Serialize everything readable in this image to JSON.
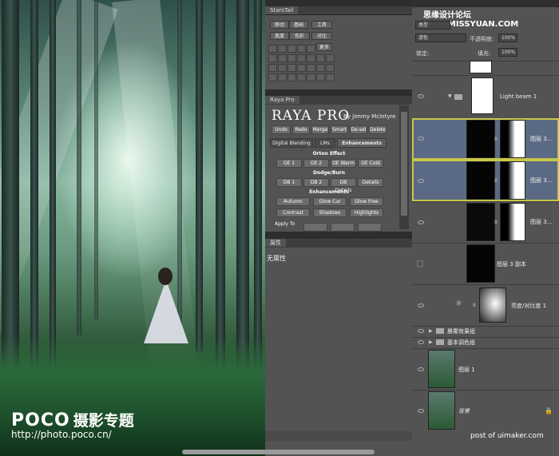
{
  "watermark": {
    "brand": "POCO",
    "subtitle": "摄影专题",
    "url": "http://photo.poco.cn/"
  },
  "top_watermark": "思缘设计论坛 www.MISSYUAN.COM",
  "startail": {
    "tab": "StarsTail",
    "buttons": [
      "移动",
      "基础",
      "工具",
      "真度",
      "色彩",
      "对比",
      "更多"
    ]
  },
  "raya": {
    "tab": "Raya Pro",
    "title": "RAYA PRO",
    "by": "By Jimmy McIntyre",
    "top_buttons": [
      "Undo",
      "Redo",
      "Merge",
      "Smart",
      "De-sel",
      "Delete"
    ],
    "tabs": [
      "Digital Blending",
      "LMs",
      "Enhancements"
    ],
    "orton_title": "Orton Effect",
    "orton": [
      "OE 1",
      "OE 2",
      "OE Warm",
      "OE Cold"
    ],
    "dodge_title": "Dodge/Burn",
    "dodge": [
      "DB 1",
      "DB 2",
      "DB Details",
      "Details"
    ],
    "enh_title": "Enhancements",
    "enh_row1": [
      "Autumn",
      "Glow Cur",
      "Glow Free"
    ],
    "enh_row2": [
      "Contrast",
      "Shadows",
      "Highlights"
    ],
    "apply_to": "Apply To"
  },
  "properties": {
    "tab": "属性",
    "empty": "无属性"
  },
  "layers_panel": {
    "kind": "类型",
    "blend": "滤色",
    "opacity_label": "不透明度:",
    "opacity": "100%",
    "lock_label": "锁定:",
    "fill_label": "填充:",
    "fill": "100%",
    "layers": [
      {
        "name": "Light beam 1"
      },
      {
        "name": "图层 3..."
      },
      {
        "name": "图层 3..."
      },
      {
        "name": "图层 3..."
      },
      {
        "name": "图层 3 副本"
      },
      {
        "name": "亮度/对比度 1"
      },
      {
        "name": "晨雾效果组"
      },
      {
        "name": "基本调色组"
      },
      {
        "name": "图层 1"
      },
      {
        "name": "背景"
      }
    ]
  },
  "credit": "post of uimaker.com"
}
